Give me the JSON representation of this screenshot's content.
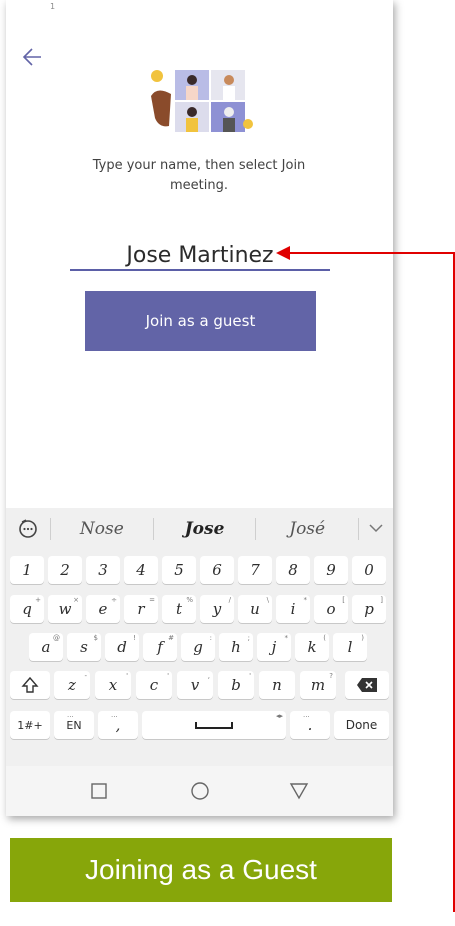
{
  "screen": {
    "status_text": "1"
  },
  "content": {
    "instruction_line1": "Type your name, then select Join",
    "instruction_line2": "meeting.",
    "name_value": "Jose Martinez",
    "join_button": "Join as a guest"
  },
  "keyboard": {
    "suggestions": [
      "Nose",
      "Jose",
      "José"
    ],
    "rows": [
      [
        [
          "1",
          ""
        ],
        [
          "2",
          ""
        ],
        [
          "3",
          ""
        ],
        [
          "4",
          ""
        ],
        [
          "5",
          ""
        ],
        [
          "6",
          ""
        ],
        [
          "7",
          ""
        ],
        [
          "8",
          ""
        ],
        [
          "9",
          ""
        ],
        [
          "0",
          ""
        ]
      ],
      [
        [
          "q",
          "+"
        ],
        [
          "w",
          "×"
        ],
        [
          "e",
          "÷"
        ],
        [
          "r",
          "="
        ],
        [
          "t",
          "%"
        ],
        [
          "y",
          "/"
        ],
        [
          "u",
          "\\"
        ],
        [
          "i",
          "*"
        ],
        [
          "o",
          "["
        ],
        [
          "p",
          "]"
        ]
      ],
      [
        [
          "a",
          "@"
        ],
        [
          "s",
          "$"
        ],
        [
          "d",
          "!"
        ],
        [
          "f",
          "#"
        ],
        [
          "g",
          ":"
        ],
        [
          "h",
          ";"
        ],
        [
          "j",
          "*"
        ],
        [
          "k",
          "("
        ],
        [
          "l",
          ")"
        ]
      ],
      [
        [
          "z",
          "-"
        ],
        [
          "x",
          "'"
        ],
        [
          "c",
          "'"
        ],
        [
          "v",
          ","
        ],
        [
          "b",
          "'"
        ],
        [
          "n",
          ""
        ],
        [
          "m",
          "?"
        ]
      ]
    ],
    "mode_key": "1#+",
    "lang_key": "EN",
    "comma_key": ",",
    "period_key": ".",
    "done_key": "Done"
  },
  "caption": {
    "text": "Joining as a Guest"
  },
  "colors": {
    "accent": "#6264a7",
    "caption_bg": "#87a60a",
    "arrow": "#e00000"
  }
}
